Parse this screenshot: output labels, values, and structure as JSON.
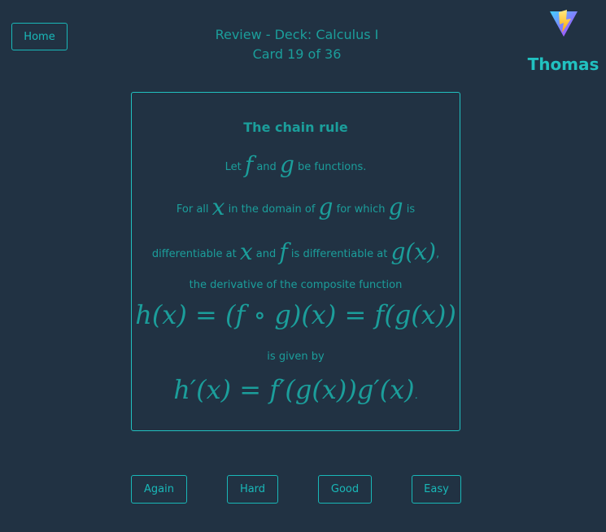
{
  "nav": {
    "home_label": "Home"
  },
  "header": {
    "review_line": "Review - Deck: Calculus I",
    "card_counter": "Card 19 of 36"
  },
  "user": {
    "name": "Thomas"
  },
  "card": {
    "title": "The chain rule",
    "line1_text_a": "Let",
    "line1_math_f": "f",
    "line1_text_b": "and",
    "line1_math_g": "g",
    "line1_text_c": "be functions.",
    "line2_text_a": "For all",
    "line2_math_x": "x",
    "line2_text_b": "in the domain of",
    "line2_math_g1": "g",
    "line2_text_c": "for which",
    "line2_math_g2": "g",
    "line2_text_d": "is",
    "line3_text_a": "differentiable at",
    "line3_math_x": "x",
    "line3_text_b": "and",
    "line3_math_f": "f",
    "line3_text_c": "is differentiable at",
    "line3_math_gx": "g(x)",
    "line3_text_d": ",",
    "composite_text": "the derivative of the composite function",
    "formula1": "h(x) = (f ∘ g)(x) = f(g(x))",
    "given_text": "is given by",
    "formula2": "h′(x) = f′(g(x))g′(x)",
    "formula2_end": "."
  },
  "answers": {
    "again": "Again",
    "hard": "Hard",
    "good": "Good",
    "easy": "Easy"
  },
  "colors": {
    "background": "#213243",
    "accent": "#21c1c0",
    "text": "#1b9e9b"
  }
}
